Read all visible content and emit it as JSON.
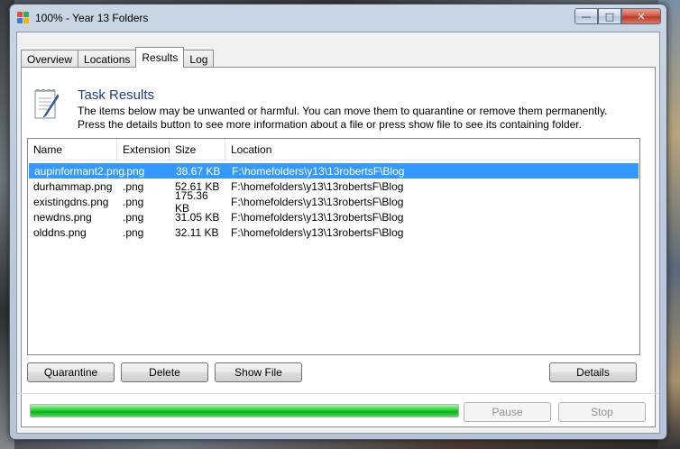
{
  "window": {
    "title": "100% - Year 13 Folders",
    "controls": {
      "minimize": "—",
      "maximize": "□",
      "close": "✕"
    }
  },
  "tabs": [
    {
      "label": "Overview",
      "active": false
    },
    {
      "label": "Locations",
      "active": false
    },
    {
      "label": "Results",
      "active": true
    },
    {
      "label": "Log",
      "active": false
    }
  ],
  "results": {
    "title": "Task Results",
    "description_line1": "The items below may be unwanted or harmful. You can move them to quarantine or remove them permanently.",
    "description_line2": "Press the details button to see more information about a file or press show file to see its containing folder.",
    "columns": [
      "Name",
      "Extension",
      "Size",
      "Location"
    ],
    "rows": [
      {
        "name": "aupinformant2.png",
        "extension": ".png",
        "size": "38.67 KB",
        "location": "F:\\homefolders\\y13\\13robertsF\\Blog",
        "selected": true
      },
      {
        "name": "durhammap.png",
        "extension": ".png",
        "size": "52.61 KB",
        "location": "F:\\homefolders\\y13\\13robertsF\\Blog",
        "selected": false
      },
      {
        "name": "existingdns.png",
        "extension": ".png",
        "size": "175.36 KB",
        "location": "F:\\homefolders\\y13\\13robertsF\\Blog",
        "selected": false
      },
      {
        "name": "newdns.png",
        "extension": ".png",
        "size": "31.05 KB",
        "location": "F:\\homefolders\\y13\\13robertsF\\Blog",
        "selected": false
      },
      {
        "name": "olddns.png",
        "extension": ".png",
        "size": "32.11 KB",
        "location": "F:\\homefolders\\y13\\13robertsF\\Blog",
        "selected": false
      }
    ]
  },
  "buttons": {
    "quarantine": "Quarantine",
    "delete": "Delete",
    "show_file": "Show File",
    "details": "Details",
    "pause": "Pause",
    "stop": "Stop"
  },
  "progress": {
    "value": 1.0
  },
  "colors": {
    "selection": "#3399ff",
    "title_blue": "#1e3a8a",
    "progress_green": "#06b025"
  }
}
